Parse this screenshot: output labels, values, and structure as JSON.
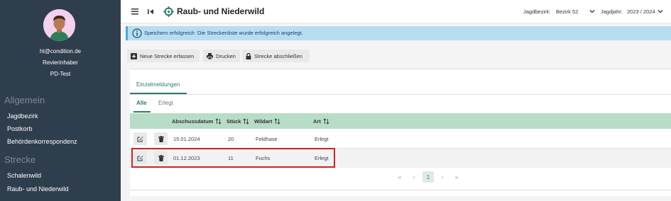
{
  "sidebar": {
    "user_email": "ht@condition.de",
    "user_role": "Revierinhaber",
    "user_org": "PD-Test",
    "sections": [
      {
        "title": "Allgemein",
        "items": [
          "Jagdbezirk",
          "Postkorb",
          "Behördenkorrespondenz"
        ]
      },
      {
        "title": "Strecke",
        "items": [
          "Schalenwild",
          "Raub- und Niederwild"
        ]
      }
    ]
  },
  "topbar": {
    "title": "Raub- und Niederwild",
    "jagdbezirk_label": "Jagdbezirk:",
    "jagdbezirk_value": "Bezirk 52",
    "jagdjahr_label": "Jagdjahr:",
    "jagdjahr_value": "2023 / 2024"
  },
  "alert": {
    "title": "Speichern erfolgreich",
    "message": "Die Streckenliste wurde erfolgreich angelegt."
  },
  "toolbar": {
    "new_label": "Neue Strecke erfassen",
    "print_label": "Drucken",
    "close_label": "Strecke abschließen"
  },
  "card": {
    "tab_label": "Einzelmeldungen",
    "subtabs": [
      "Alle",
      "Erlegt"
    ],
    "columns": [
      "Abschussdatum",
      "Stück",
      "Wildart",
      "Art"
    ],
    "rows": [
      {
        "date": "15.01.2024",
        "count": "20",
        "species": "Feldhase",
        "type": "Erlegt"
      },
      {
        "date": "01.12.2023",
        "count": "11",
        "species": "Fuchs",
        "type": "Erlegt"
      }
    ],
    "pager": {
      "first": "«",
      "prev": "‹",
      "current": "1",
      "next": "›",
      "last": "»"
    }
  },
  "colors": {
    "sidebar_bg": "#2f3e4d",
    "accent_green": "#2e7d5b",
    "header_green": "#b7dcc7",
    "alert_bg": "#b8ddf1",
    "highlight_red": "#d32020"
  }
}
